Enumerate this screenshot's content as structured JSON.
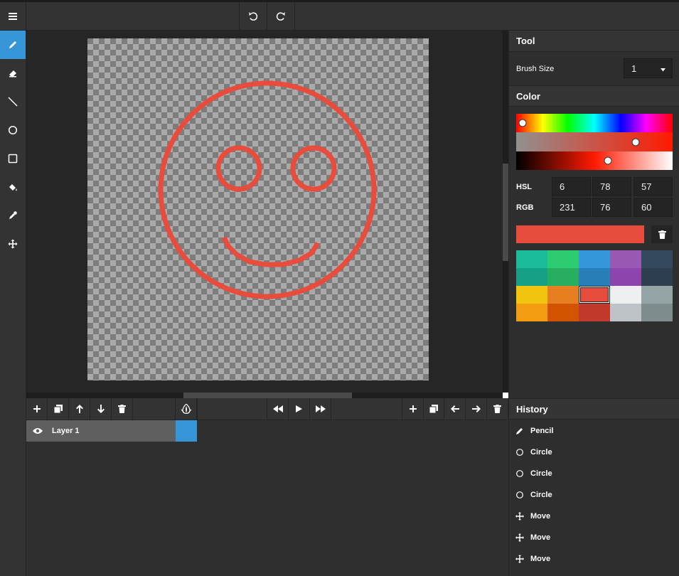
{
  "tools": [
    {
      "name": "pencil-icon",
      "active": true
    },
    {
      "name": "eraser-icon",
      "active": false
    },
    {
      "name": "line-icon",
      "active": false
    },
    {
      "name": "circle-icon",
      "active": false
    },
    {
      "name": "rectangle-icon",
      "active": false
    },
    {
      "name": "paint-bucket-icon",
      "active": false
    },
    {
      "name": "eyedropper-icon",
      "active": false
    },
    {
      "name": "move-icon",
      "active": false
    }
  ],
  "tool_panel": {
    "title": "Tool",
    "brush_size_label": "Brush Size",
    "brush_size_value": "1"
  },
  "color_panel": {
    "title": "Color",
    "hsl_label": "HSL",
    "hsl": [
      "6",
      "78",
      "57"
    ],
    "rgb_label": "RGB",
    "rgb": [
      "231",
      "76",
      "60"
    ],
    "current_color": "#e74c3c",
    "palette": [
      [
        "#1abc9c",
        "#2ecc71",
        "#3498db",
        "#9b59b6",
        "#34495e"
      ],
      [
        "#16a085",
        "#27ae60",
        "#2980b9",
        "#8e44ad",
        "#2c3e50"
      ],
      [
        "#f1c40f",
        "#e67e22",
        "#e74c3c",
        "#ecf0f1",
        "#95a5a6"
      ],
      [
        "#f39c12",
        "#d35400",
        "#c0392b",
        "#bdc3c7",
        "#7f8c8d"
      ]
    ],
    "selected_swatch": "#e74c3c"
  },
  "layers": [
    {
      "name": "Layer 1",
      "visible": true
    }
  ],
  "history_panel": {
    "title": "History",
    "items": [
      {
        "icon": "pencil-icon",
        "label": "Pencil"
      },
      {
        "icon": "circle-icon",
        "label": "Circle"
      },
      {
        "icon": "circle-icon",
        "label": "Circle"
      },
      {
        "icon": "circle-icon",
        "label": "Circle"
      },
      {
        "icon": "move-icon",
        "label": "Move"
      },
      {
        "icon": "move-icon",
        "label": "Move"
      },
      {
        "icon": "move-icon",
        "label": "Move"
      }
    ]
  }
}
